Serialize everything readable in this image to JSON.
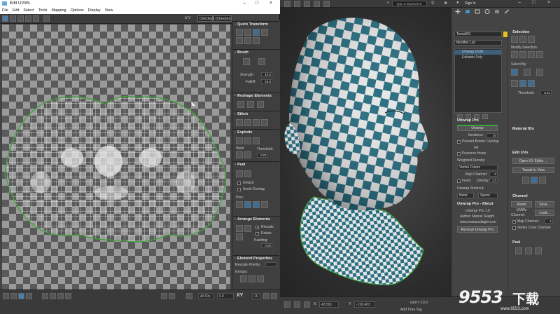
{
  "uv_editor": {
    "window_title": "Edit UVWs",
    "window_controls": [
      "–",
      "□",
      "×"
    ],
    "menu": [
      "File",
      "Edit",
      "Select",
      "Tools",
      "Mapping",
      "Options",
      "Display",
      "View"
    ],
    "uv_toggle": "U V",
    "checker_name": "CheckerPatt",
    "checker_dropdown": "(Checker)",
    "status": {
      "lock_label": "All IDs",
      "u_value": "0.0",
      "xy_label": "XY",
      "value_16": "16"
    }
  },
  "rollouts": {
    "quick_transform": {
      "title": "Quick Transform"
    },
    "brush": {
      "title": "Brush",
      "strength_label": "Strength:",
      "strength_value": "10.0",
      "falloff_label": "Falloff:",
      "falloff_value": "20.0"
    },
    "reshape": {
      "title": "Reshape Elements"
    },
    "stitch": {
      "title": "Stitch"
    },
    "explode": {
      "title": "Explode",
      "weld_label": "Weld",
      "threshold_label": "Threshold:",
      "threshold_value": "0.01"
    },
    "peel": {
      "title": "Peel",
      "detach_label": "Detach",
      "avoid_overlap_label": "Avoid Overlap",
      "pins_label": "Pins:"
    },
    "arrange": {
      "title": "Arrange Elements",
      "rescale_label": "Rescale",
      "rotate_label": "Rotate",
      "padding_label": "Padding:",
      "padding_value": "0.02"
    },
    "element_props": {
      "title": "Element Properties",
      "rescale_priority_label": "Rescale Priority:",
      "groups_label": "Groups:"
    }
  },
  "max": {
    "search_placeholder": "Type a keyword or phrase",
    "signin_label": "Sign In",
    "object_name": "Torso001",
    "modifier_list_label": "Modifier List",
    "stack": [
      "Unwrap UVW",
      "Editable Poly"
    ],
    "selection": {
      "title": "Selection",
      "modify_label": "Modify Selection:",
      "select_by_label": "Select By:",
      "threshold_label": "Threshold:",
      "threshold_value": "0.01"
    },
    "material_ids": {
      "title": "Material IDs"
    },
    "edit_uvs": {
      "title": "Edit UVs",
      "open_editor_label": "Open UV Editor ...",
      "tweak_label": "Tweak In View"
    },
    "channel": {
      "title": "Channel",
      "reset_label": "Reset UVWs",
      "save_label": "Save...",
      "load_label": "Load...",
      "channel_label": "Channel:",
      "map_channel_label": "Map Channel:",
      "map_channel_value": "1",
      "vertex_color_label": "Vertex Color Channel"
    },
    "peel": {
      "title": "Peel"
    },
    "unwrap_pro": {
      "title": "Unwrap Pro",
      "button_label": "Unwrap",
      "iterations_label": "Iterations:",
      "iterations_value": "30",
      "prevent_border_label": "Prevent Border Overlap",
      "fill_label": "Fill",
      "preserve_holes_label": "Preserve Holes",
      "weighted_density_label": "Weighted Density:",
      "vertex_colors_label": "Vertex Colors",
      "map_channel_label": "Map Channel:",
      "map_channel_value": "0",
      "invert_label": "Invert",
      "density_label": "Density:",
      "density_value": "1.0",
      "shortcut_label": "Unwrap Shortcut:",
      "shortcut_none": "None",
      "shortcut_space": "Space"
    },
    "about": {
      "title": "Unwrap Pro - About",
      "version": "Unwrap Pro 1.0",
      "author": "Author: Marius Silaghi",
      "website": "www.mariussilaghi.com",
      "remove_label": "Remove Unwrap Pro"
    },
    "bottom": {
      "x_label": "X:",
      "x_value": "43.591",
      "y_label": "Y:",
      "y_value": "-158.403",
      "grid_label": "Grid = 10.0",
      "add_time_tag": "Add Time Tag"
    }
  },
  "watermark": {
    "brand": "9553",
    "suffix": "下载",
    "domain": "www.9553.com"
  },
  "colors": {
    "checker_teal": "#2b6f82",
    "checker_white": "#e6e6e6",
    "seam_green": "#3fa33a",
    "uv_grid_white": "#f0f0f0"
  }
}
